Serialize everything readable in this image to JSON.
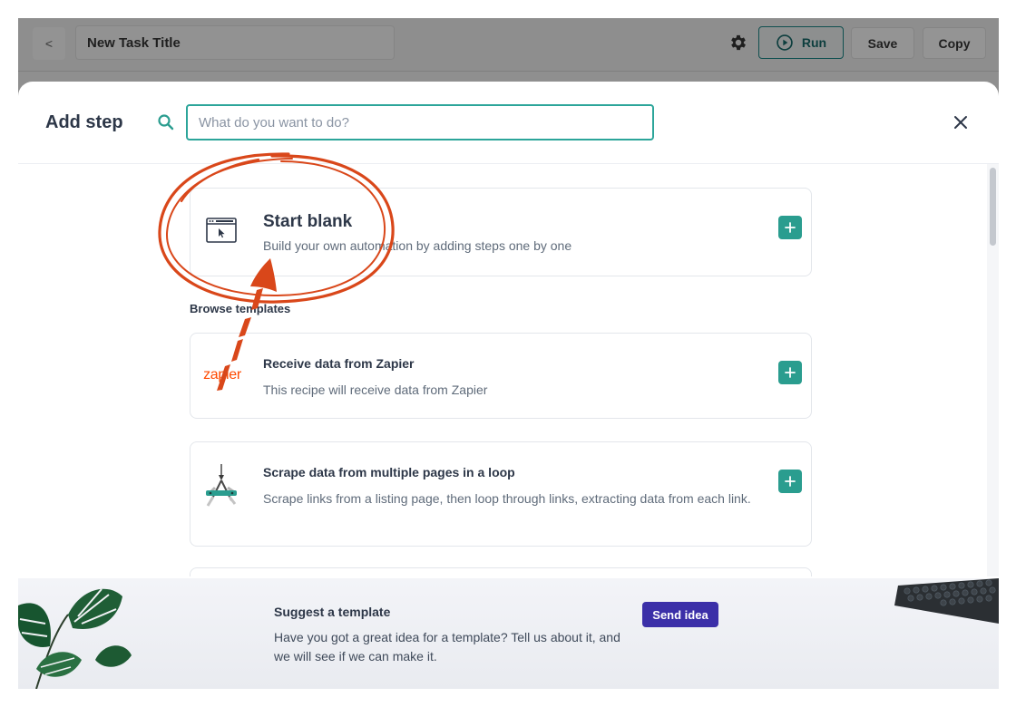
{
  "topbar": {
    "back_label": "<",
    "task_title": "New Task Title",
    "run_label": "Run",
    "save_label": "Save",
    "copy_label": "Copy"
  },
  "modal": {
    "title": "Add step",
    "search_placeholder": "What do you want to do?",
    "close_label": "×"
  },
  "start_blank": {
    "title": "Start blank",
    "description": "Build your own automation by adding steps one by one"
  },
  "browse_label": "Browse templates",
  "templates": [
    {
      "logo_text": "zapier",
      "title": "Receive data from Zapier",
      "description": "This recipe will receive data from Zapier"
    },
    {
      "title": "Scrape data from multiple pages in a loop",
      "description": "Scrape links from a listing page, then loop through links, extracting data from each link."
    }
  ],
  "footer": {
    "title": "Suggest a template",
    "text": "Have you got a great idea for a template? Tell us about it, and we will see if we can make it.",
    "send_label": "Send idea"
  },
  "colors": {
    "accent": "#2a9d8f",
    "send_button": "#3b2fa8",
    "annotation": "#d9471a",
    "zapier": "#ff4a00"
  }
}
